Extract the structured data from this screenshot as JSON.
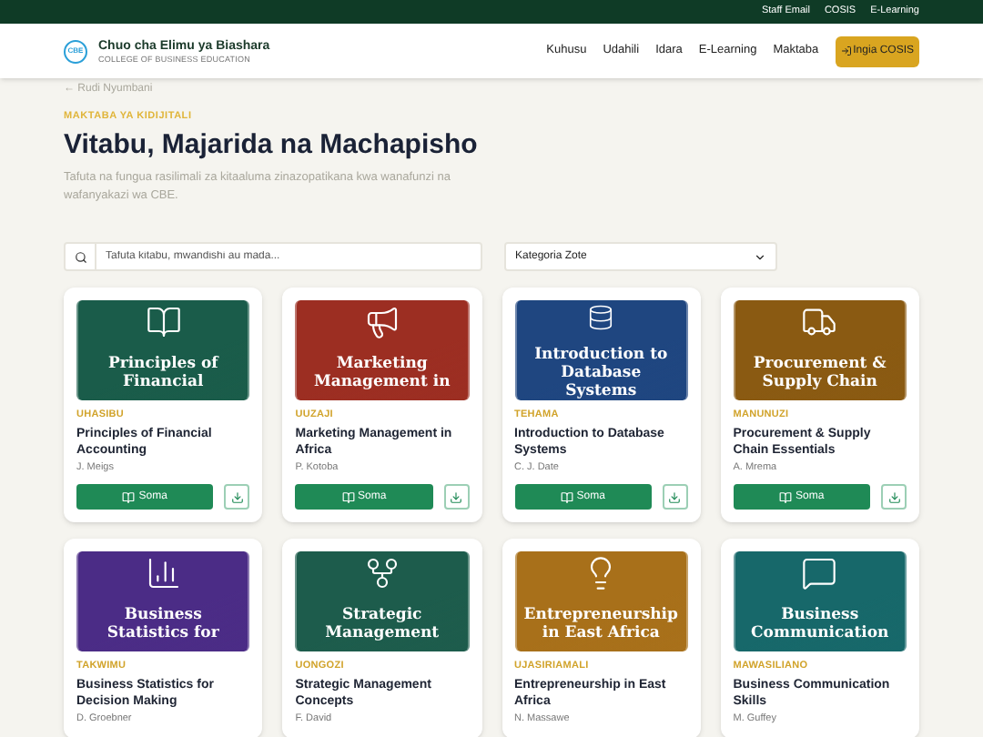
{
  "top_bar": {
    "links": [
      "Staff Email",
      "COSIS",
      "E-Learning"
    ]
  },
  "header": {
    "name": "Chuo cha Elimu ya Biashara",
    "subtitle": "COLLEGE OF BUSINESS EDUCATION",
    "logo_text": "CBE",
    "nav": [
      "Kuhusu",
      "Udahili",
      "Idara",
      "E-Learning",
      "Maktaba"
    ],
    "cta": "Ingia COSIS"
  },
  "back_link": "← Rudi Nyumbani",
  "eyebrow": "MAKTABA YA KIDIJITALI",
  "title": "Vitabu, Majarida na Machapisho",
  "description": "Tafuta na fungua rasilimali za kitaaluma zinazopatikana kwa wanafunzi na wafanyakazi wa CBE.",
  "search": {
    "placeholder": "Tafuta kitabu, mwandishi au mada..."
  },
  "category_select": {
    "value": "Kategoria Zote"
  },
  "books": [
    {
      "kind": "book",
      "color": "#1a5c4a",
      "cover_title": "Principles of Financial",
      "category": "UHASIBU",
      "title": "Principles of Financial Accounting",
      "author": "J. Meigs",
      "read": "Soma"
    },
    {
      "kind": "megaphone",
      "color": "#9c2e22",
      "cover_title": "Marketing Management in",
      "category": "UUZAJI",
      "title": "Marketing Management in Africa",
      "author": "P. Kotoba",
      "read": "Soma"
    },
    {
      "kind": "database",
      "color": "#1f4680",
      "cover_title": "Introduction to Database Systems",
      "category": "TEHAMA",
      "title": "Introduction to Database Systems",
      "author": "C. J. Date",
      "read": "Soma"
    },
    {
      "kind": "truck",
      "color": "#8a5a12",
      "cover_title": "Procurement & Supply Chain",
      "category": "MANUNUZI",
      "title": "Procurement & Supply Chain Essentials",
      "author": "A. Mrema",
      "read": "Soma"
    },
    {
      "kind": "chart",
      "color": "#4b2c86",
      "cover_title": "Business Statistics for",
      "category": "TAKWIMU",
      "title": "Business Statistics for Decision Making",
      "author": "D. Groebner"
    },
    {
      "kind": "network",
      "color": "#1d5c4c",
      "cover_title": "Strategic Management",
      "category": "UONGOZI",
      "title": "Strategic Management Concepts",
      "author": "F. David"
    },
    {
      "kind": "bulb",
      "color": "#a8701a",
      "cover_title": "Entrepreneurship in East Africa",
      "category": "UJASIRIAMALI",
      "title": "Entrepreneurship in East Africa",
      "author": "N. Massawe"
    },
    {
      "kind": "message",
      "color": "#17686a",
      "cover_title": "Business Communication",
      "category": "MAWASILIANO",
      "title": "Business Communication Skills",
      "author": "M. Guffey"
    }
  ]
}
